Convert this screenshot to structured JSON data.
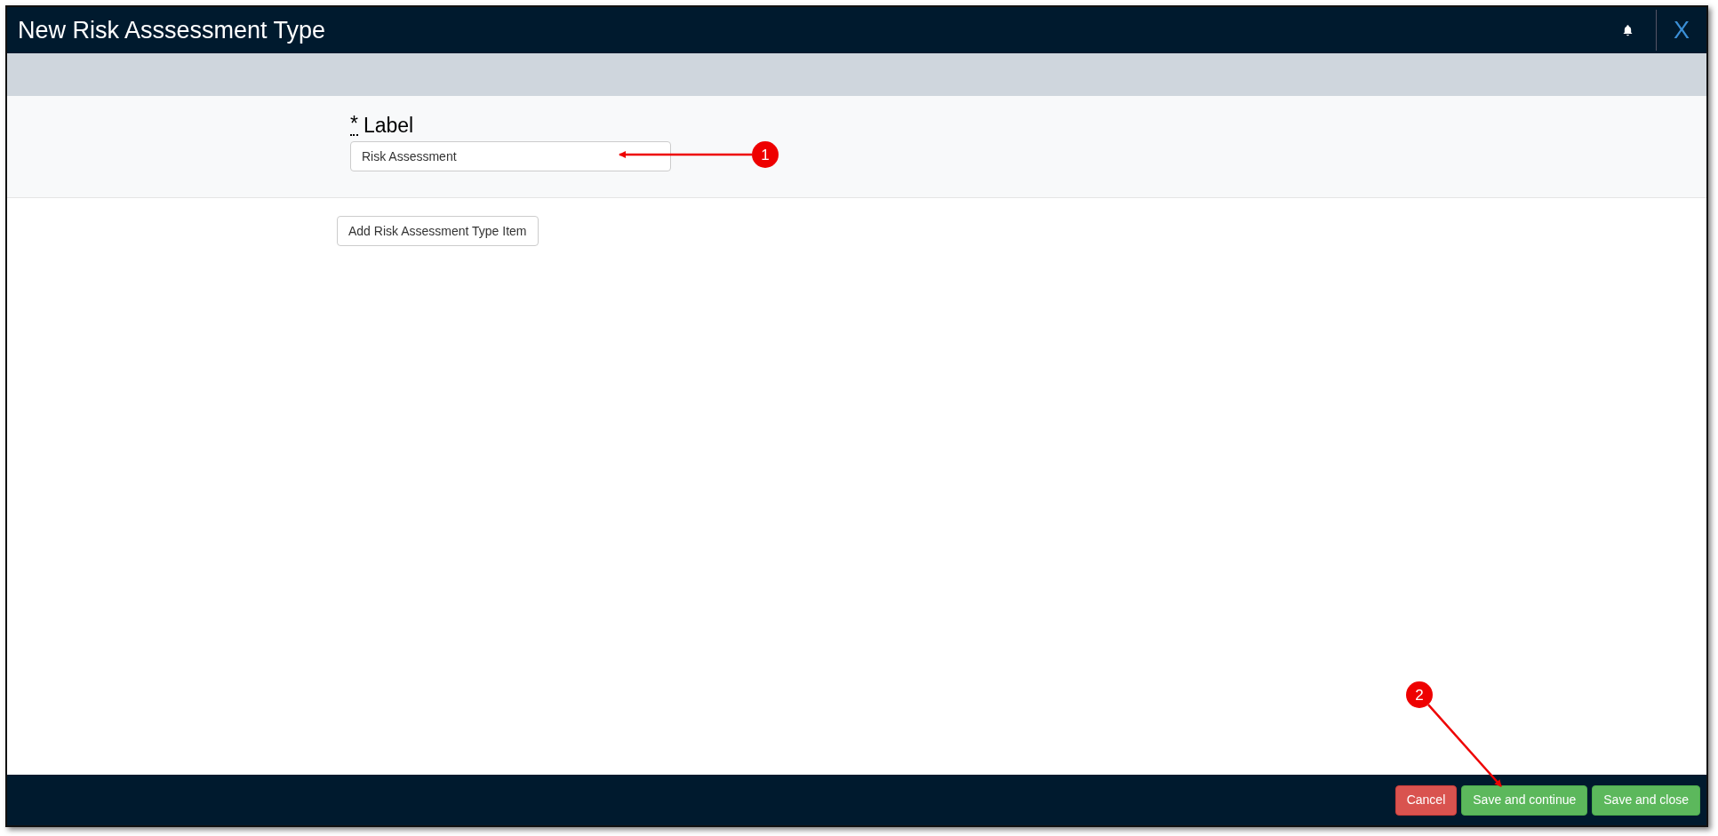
{
  "window": {
    "title": "New Risk Asssessment Type",
    "close": "X"
  },
  "form": {
    "required_mark": "*",
    "label": "Label",
    "value": "Risk Assessment"
  },
  "add_button": "Add Risk Assessment Type Item",
  "footer_buttons": [
    {
      "label": "Cancel",
      "kind": "danger"
    },
    {
      "label": "Save and continue",
      "kind": "success"
    },
    {
      "label": "Save and close",
      "kind": "success"
    }
  ],
  "annotations": [
    "1",
    "2"
  ]
}
